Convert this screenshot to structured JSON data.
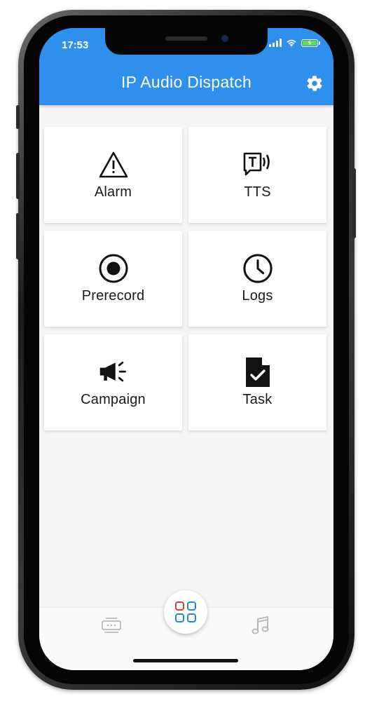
{
  "status_bar": {
    "time": "17:53"
  },
  "app_bar": {
    "title": "IP Audio Dispatch",
    "settings_icon": "gear-icon"
  },
  "tiles": [
    {
      "label": "Alarm",
      "icon": "warning-triangle-icon"
    },
    {
      "label": "TTS",
      "icon": "text-to-speech-icon"
    },
    {
      "label": "Prerecord",
      "icon": "record-icon"
    },
    {
      "label": "Logs",
      "icon": "clock-icon"
    },
    {
      "label": "Campaign",
      "icon": "megaphone-icon"
    },
    {
      "label": "Task",
      "icon": "document-check-icon"
    }
  ],
  "bottom_nav": {
    "left_icon": "dispatch-device-icon",
    "center_icon": "grid-apps-icon",
    "right_icon": "music-note-icon"
  },
  "colors": {
    "accent": "#2e90ec",
    "background": "#f5f5f5",
    "tile": "#ffffff"
  }
}
